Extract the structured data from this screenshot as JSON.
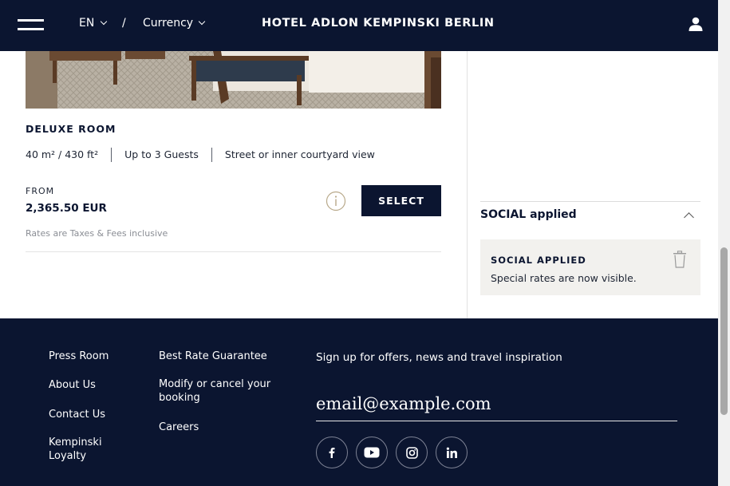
{
  "header": {
    "language": "EN",
    "separator": "/",
    "currency_label": "Currency",
    "brand": "HOTEL ADLON KEMPINSKI BERLIN"
  },
  "room": {
    "title": "DELUXE ROOM",
    "facts": [
      "40 m² / 430 ft²",
      "Up to 3 Guests",
      "Street or inner courtyard view"
    ],
    "from_label": "FROM",
    "price": "2,365.50 EUR",
    "select_label": "SELECT",
    "rates_note": "Rates are Taxes & Fees inclusive"
  },
  "promo": {
    "header": "SOCIAL applied",
    "card_title": "SOCIAL APPLIED",
    "card_text": "Special rates are now visible."
  },
  "footer": {
    "col1": [
      "Press Room",
      "About Us",
      "Contact Us",
      "Kempinski Loyalty"
    ],
    "col2": [
      "Best Rate Guarantee",
      "Modify or cancel your booking",
      "Careers"
    ],
    "newsletter_label": "Sign up for offers, news and travel inspiration",
    "email_placeholder": "email@example.com",
    "social_icons": [
      "facebook-icon",
      "youtube-icon",
      "instagram-icon",
      "linkedin-icon"
    ]
  },
  "colors": {
    "navy": "#0b1530",
    "promo_card_bg": "#f2f1ee",
    "info_icon": "#b8a98a"
  }
}
